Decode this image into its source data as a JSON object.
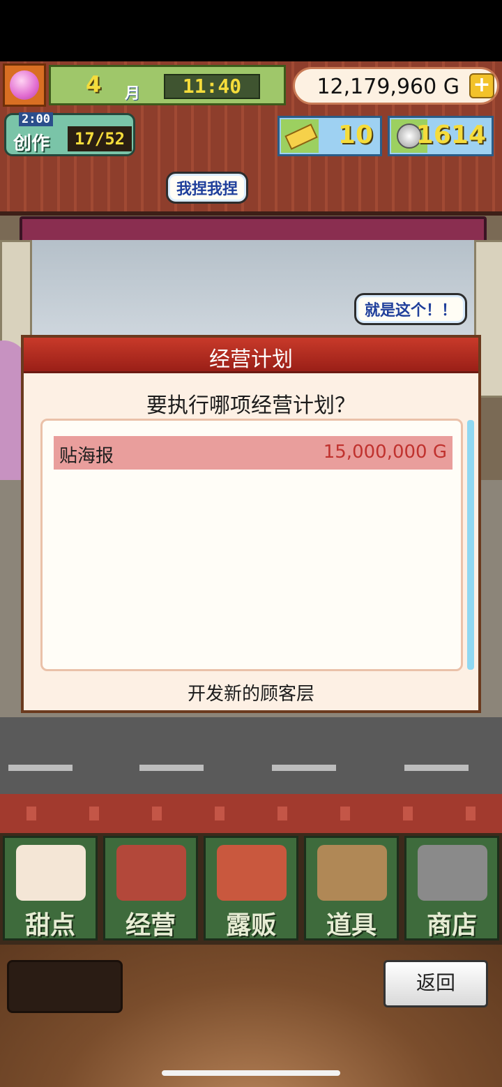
{
  "hud": {
    "month_number": "4",
    "month_label": "月",
    "time": "11:40",
    "gold": "12,179,960 G",
    "gold_add": "+",
    "create_timer": "2:00",
    "create_label": "创作",
    "create_count": "17/52",
    "tickets": "10",
    "medals": "1614"
  },
  "bubbles": {
    "left": "我捏我捏",
    "right": "就是这个！！"
  },
  "dialog": {
    "title": "经营计划",
    "question": "要执行哪项经营计划？",
    "plans": [
      {
        "name": "贴海报",
        "price": "15,000,000 G"
      }
    ],
    "footer": "开发新的顾客层"
  },
  "nav": {
    "items": [
      {
        "label": "甜点",
        "icon": "cake-icon"
      },
      {
        "label": "经营",
        "icon": "shop-icon"
      },
      {
        "label": "露贩",
        "icon": "food-truck-icon"
      },
      {
        "label": "道具",
        "icon": "tools-bag-icon"
      },
      {
        "label": "商店",
        "icon": "cart-icon"
      }
    ]
  },
  "back_button": "返回",
  "colors": {
    "dialog_header": "#b02a1f",
    "plan_row": "#e99e9c",
    "plan_price": "#c0322e",
    "nav_button": "#3e6b3c"
  }
}
